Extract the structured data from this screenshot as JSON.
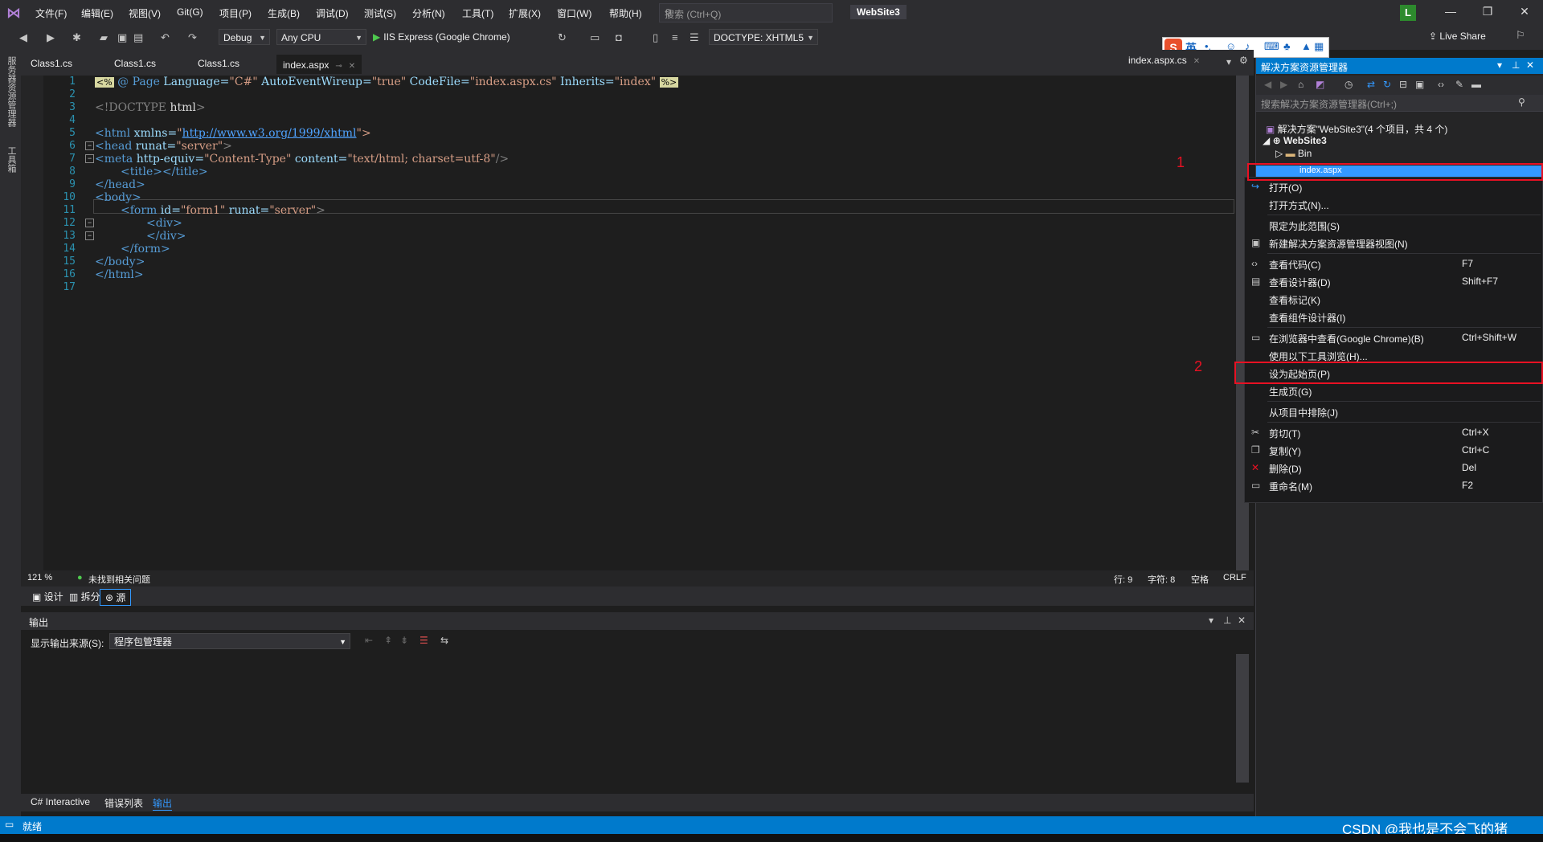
{
  "menubar": {
    "items": [
      "文件(F)",
      "编辑(E)",
      "视图(V)",
      "Git(G)",
      "项目(P)",
      "生成(B)",
      "调试(D)",
      "测试(S)",
      "分析(N)",
      "工具(T)",
      "扩展(X)",
      "窗口(W)",
      "帮助(H)"
    ],
    "search_placeholder": "搜索 (Ctrl+Q)",
    "solution_name": "WebSite3",
    "avatar_letter": "L"
  },
  "toolbar": {
    "config": "Debug",
    "platform": "Any CPU",
    "run_target": "IIS Express (Google Chrome)",
    "doctype": "DOCTYPE: XHTML5",
    "live_share": "Live Share"
  },
  "ime": {
    "lang": "英",
    "logo": "S"
  },
  "side_strip": {
    "labels": [
      "服务器资源管理器",
      "工具箱"
    ]
  },
  "doc_tabs": {
    "tabs": [
      "Class1.cs",
      "Class1.cs",
      "Class1.cs",
      "index.aspx"
    ],
    "right_tab": "index.aspx.cs"
  },
  "editor": {
    "line_numbers": [
      "1",
      "2",
      "3",
      "4",
      "5",
      "6",
      "7",
      "8",
      "9",
      "10",
      "11",
      "12",
      "13",
      "14",
      "15",
      "16",
      "17"
    ],
    "lines": {
      "l1": {
        "open": "@ Page",
        "a1": " Language=",
        "v1": "\"C#\"",
        "a2": " AutoEventWireup=",
        "v2": "\"true\"",
        "a3": " CodeFile=",
        "v3": "\"index.aspx.cs\"",
        "a4": " Inherits=",
        "v4": "\"index\""
      },
      "l3": {
        "open": "<!DOCTYPE",
        "tag": " html",
        "close": ">"
      },
      "l5": {
        "open": "<html",
        "attr": " xmlns=",
        "q": "\"",
        "url": "http://www.w3.org/1999/xhtml",
        "close": "\">"
      },
      "l6": {
        "open": "<head",
        "attr": " runat=",
        "val": "\"server\"",
        "close": ">"
      },
      "l7": {
        "open": "<meta",
        "a1": " http-equiv=",
        "v1": "\"Content-Type\"",
        "a2": " content=",
        "v2": "\"text/html; charset=utf-8\"",
        "close": "/>"
      },
      "l8": {
        "text": "<title></title>"
      },
      "l9": {
        "text": "</head>"
      },
      "l10": {
        "text": "<body>"
      },
      "l11": {
        "open": "<form",
        "a1": " id=",
        "v1": "\"form1\"",
        "a2": " runat=",
        "v2": "\"server\"",
        "close": ">"
      },
      "l12": {
        "text": "<div>"
      },
      "l13": {
        "text": "</div>"
      },
      "l14": {
        "text": "</form>"
      },
      "l15": {
        "text": "</body>"
      },
      "l16": {
        "text": "</html>"
      }
    }
  },
  "editor_status": {
    "zoom": "121 %",
    "issues": "未找到相关问题",
    "line": "行: 9",
    "char": "字符: 8",
    "whitespace": "空格",
    "eol": "CRLF"
  },
  "view_tabs": [
    "设计",
    "拆分",
    "源"
  ],
  "output": {
    "title": "输出",
    "source_label": "显示输出来源(S):",
    "source_value": "程序包管理器"
  },
  "bottom_tabs": [
    "C# Interactive",
    "错误列表",
    "输出"
  ],
  "statusbar": {
    "text": "就绪",
    "watermark": "CSDN @我也是不会飞的猪"
  },
  "solution_explorer": {
    "title": "解决方案资源管理器",
    "search_placeholder": "搜索解决方案资源管理器(Ctrl+;)",
    "tree": {
      "solution": "解决方案\"WebSite3\"(4 个项目，共 4 个)",
      "project": "WebSite3",
      "bin": "Bin",
      "selected": "index.aspx"
    }
  },
  "context_menu": {
    "items": [
      {
        "label": "打开(O)",
        "shortcut": ""
      },
      {
        "label": "打开方式(N)...",
        "shortcut": ""
      },
      {
        "label": "限定为此范围(S)",
        "shortcut": ""
      },
      {
        "label": "新建解决方案资源管理器视图(N)",
        "shortcut": ""
      },
      {
        "label": "查看代码(C)",
        "shortcut": "F7"
      },
      {
        "label": "查看设计器(D)",
        "shortcut": "Shift+F7"
      },
      {
        "label": "查看标记(K)",
        "shortcut": ""
      },
      {
        "label": "查看组件设计器(I)",
        "shortcut": ""
      },
      {
        "label": "在浏览器中查看(Google Chrome)(B)",
        "shortcut": "Ctrl+Shift+W"
      },
      {
        "label": "使用以下工具浏览(H)...",
        "shortcut": ""
      },
      {
        "label": "设为起始页(P)",
        "shortcut": ""
      },
      {
        "label": "生成页(G)",
        "shortcut": ""
      },
      {
        "label": "从项目中排除(J)",
        "shortcut": ""
      },
      {
        "label": "剪切(T)",
        "shortcut": "Ctrl+X"
      },
      {
        "label": "复制(Y)",
        "shortcut": "Ctrl+C"
      },
      {
        "label": "删除(D)",
        "shortcut": "Del"
      },
      {
        "label": "重命名(M)",
        "shortcut": "F2"
      }
    ]
  },
  "annotations": {
    "n1": "1",
    "n2": "2"
  },
  "colors": {
    "accent": "#007acc",
    "annotation": "#e81123",
    "background": "#1e1e1e"
  }
}
